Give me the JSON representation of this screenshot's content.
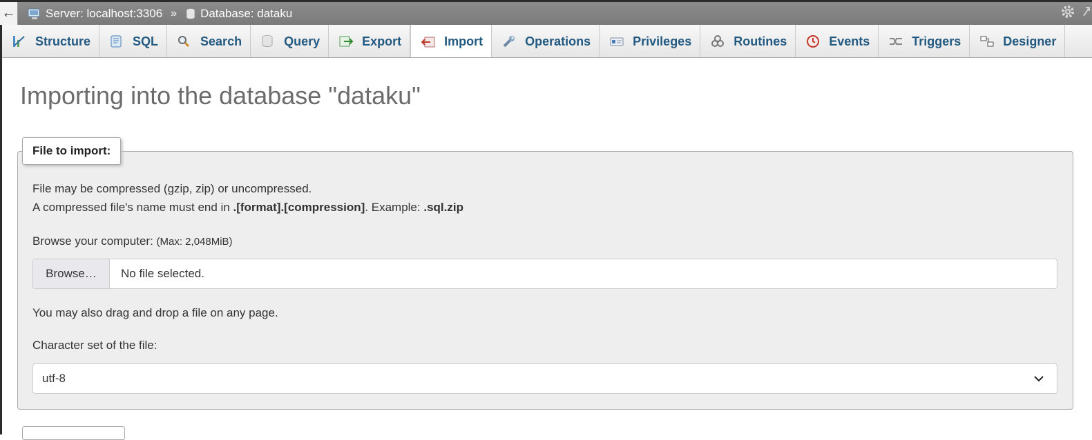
{
  "breadcrumb": {
    "back_glyph": "←",
    "server": "Server: localhost:3306",
    "separator": "»",
    "database": "Database: dataku"
  },
  "tabs": [
    {
      "label": "Structure",
      "icon": "structure-icon"
    },
    {
      "label": "SQL",
      "icon": "sql-icon"
    },
    {
      "label": "Search",
      "icon": "search-icon"
    },
    {
      "label": "Query",
      "icon": "query-icon"
    },
    {
      "label": "Export",
      "icon": "export-icon"
    },
    {
      "label": "Import",
      "icon": "import-icon",
      "active": true
    },
    {
      "label": "Operations",
      "icon": "wrench-icon"
    },
    {
      "label": "Privileges",
      "icon": "privileges-icon"
    },
    {
      "label": "Routines",
      "icon": "routines-icon"
    },
    {
      "label": "Events",
      "icon": "clock-icon"
    },
    {
      "label": "Triggers",
      "icon": "triggers-icon"
    },
    {
      "label": "Designer",
      "icon": "designer-icon"
    }
  ],
  "main": {
    "title": "Importing into the database \"dataku\"",
    "fieldset_legend": "File to import:",
    "compress_note": "File may be compressed (gzip, zip) or uncompressed.",
    "name_note_prefix": "A compressed file's name must end in ",
    "name_note_format": ".[format].[compression]",
    "name_note_mid": ". Example: ",
    "name_note_example": ".sql.zip",
    "browse_label": "Browse your computer: ",
    "browse_max": "(Max: 2,048MiB)",
    "browse_button": "Browse…",
    "file_status": "No file selected.",
    "drag_note": "You may also drag and drop a file on any page.",
    "charset_label": "Character set of the file:",
    "charset_value": "utf-8"
  },
  "colors": {
    "tab_text": "#235a81",
    "title_text": "#6b6b6b",
    "fieldset_bg": "#eeeeee"
  }
}
